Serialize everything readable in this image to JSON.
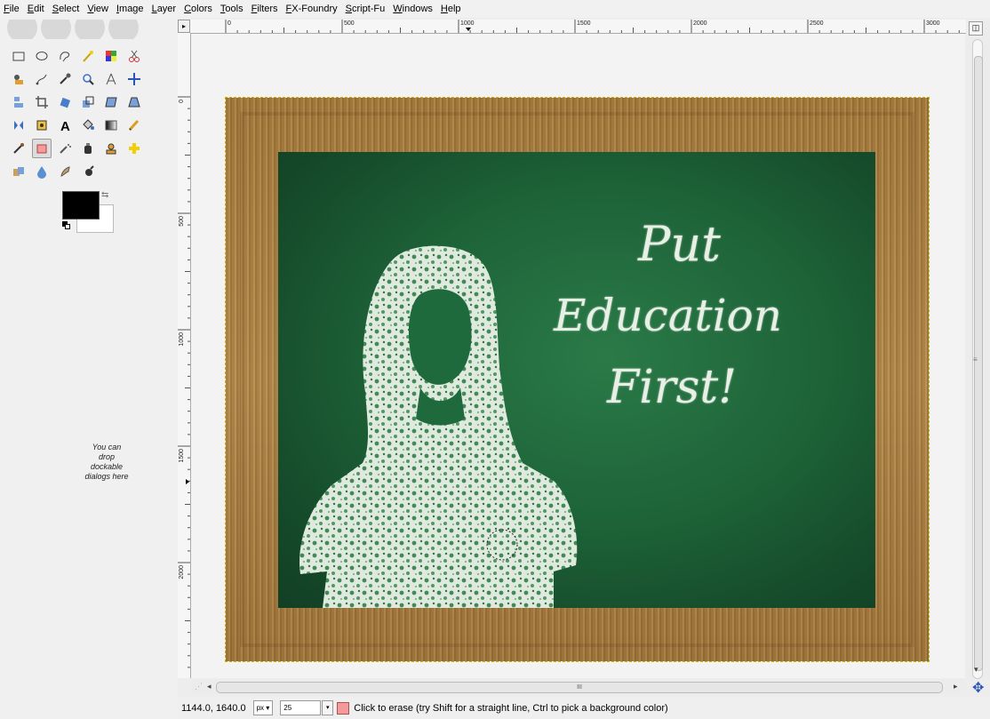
{
  "menubar": {
    "items": [
      "File",
      "Edit",
      "Select",
      "View",
      "Image",
      "Layer",
      "Colors",
      "Tools",
      "Filters",
      "FX-Foundry",
      "Script-Fu",
      "Windows",
      "Help"
    ]
  },
  "toolbox": {
    "tools": [
      {
        "name": "rect-select-icon",
        "active": false
      },
      {
        "name": "ellipse-select-icon",
        "active": false
      },
      {
        "name": "free-select-icon",
        "active": false
      },
      {
        "name": "fuzzy-select-icon",
        "active": false
      },
      {
        "name": "select-by-color-icon",
        "active": false
      },
      {
        "name": "scissors-select-icon",
        "active": false
      },
      {
        "name": "foreground-select-icon",
        "active": false
      },
      {
        "name": "paths-icon",
        "active": false
      },
      {
        "name": "color-picker-icon",
        "active": false
      },
      {
        "name": "zoom-icon",
        "active": false
      },
      {
        "name": "measure-icon",
        "active": false
      },
      {
        "name": "move-icon",
        "active": false
      },
      {
        "name": "align-icon",
        "active": false
      },
      {
        "name": "crop-icon",
        "active": false
      },
      {
        "name": "rotate-icon",
        "active": false
      },
      {
        "name": "scale-icon",
        "active": false
      },
      {
        "name": "shear-icon",
        "active": false
      },
      {
        "name": "perspective-icon",
        "active": false
      },
      {
        "name": "flip-icon",
        "active": false
      },
      {
        "name": "cage-transform-icon",
        "active": false
      },
      {
        "name": "text-icon",
        "active": false
      },
      {
        "name": "bucket-fill-icon",
        "active": false
      },
      {
        "name": "blend-icon",
        "active": false
      },
      {
        "name": "pencil-icon",
        "active": false
      },
      {
        "name": "paintbrush-icon",
        "active": false
      },
      {
        "name": "eraser-icon",
        "active": true
      },
      {
        "name": "airbrush-icon",
        "active": false
      },
      {
        "name": "ink-icon",
        "active": false
      },
      {
        "name": "clone-icon",
        "active": false
      },
      {
        "name": "heal-icon",
        "active": false
      },
      {
        "name": "perspective-clone-icon",
        "active": false
      },
      {
        "name": "blur-icon",
        "active": false
      },
      {
        "name": "smudge-icon",
        "active": false
      },
      {
        "name": "dodge-burn-icon",
        "active": false
      }
    ],
    "foreground_color": "#000000",
    "background_color": "#ffffff",
    "dock_hint": "You can drop dockable dialogs here"
  },
  "rulers": {
    "top_labels": [
      "0",
      "500",
      "1000",
      "1500",
      "2000",
      "2500",
      "3000"
    ],
    "left_labels": [
      "0",
      "500",
      "1000",
      "1500",
      "2000"
    ]
  },
  "canvas": {
    "board_text_line1": "Put",
    "board_text_line2": "Education",
    "board_text_line3": "First!",
    "frame_color": "#a97d40",
    "board_color": "#1e6439"
  },
  "hscroll": {
    "thumb_label": "III"
  },
  "statusbar": {
    "coords": "1144.0, 1640.0",
    "unit": "px",
    "zoom": "25",
    "message": "Click to erase (try Shift for a straight line, Ctrl to pick a background color)"
  }
}
